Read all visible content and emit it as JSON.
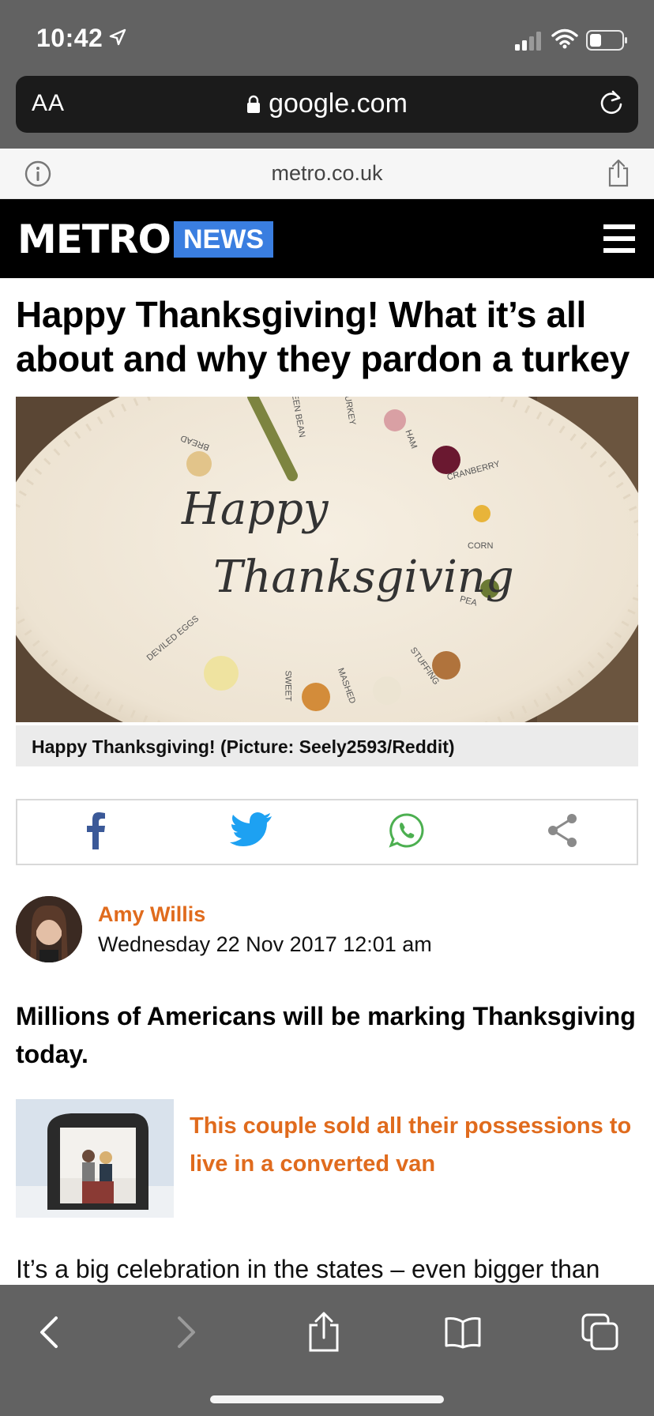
{
  "status": {
    "time": "10:42"
  },
  "browser": {
    "aa_label": "AA",
    "url": "google.com",
    "site_domain": "metro.co.uk"
  },
  "header": {
    "logo": "METRO",
    "section": "NEWS"
  },
  "article": {
    "headline": "Happy Thanksgiving! What it’s all about and why they pardon a turkey",
    "hero_image": {
      "handwritten": [
        "Happy",
        "Thanksgiving"
      ],
      "plate_labels": [
        "BREAD",
        "GREEN BEAN",
        "TURKEY",
        "HAM",
        "CRANBERRY",
        "CORN",
        "PEA",
        "STUFFING",
        "MASHED",
        "SWEET",
        "DEVILED EGGS"
      ]
    },
    "caption": "Happy Thanksgiving! (Picture: Seely2593/Reddit)",
    "share_buttons": [
      "facebook-icon",
      "twitter-icon",
      "whatsapp-icon",
      "share-icon"
    ],
    "author": {
      "name": "Amy Willis",
      "date": "Wednesday 22 Nov 2017 12:01 am"
    },
    "lede": "Millions of Americans will be marking Thanksgiving today.",
    "related": {
      "title": "This couple sold all their possessions to live in a converted van"
    },
    "body_first_line": "It’s a big celebration in the states – even bigger than"
  },
  "colors": {
    "accent_orange": "#e06b1d",
    "news_blue": "#3a7ee0",
    "facebook": "#3b5998",
    "twitter": "#1da1f2",
    "whatsapp": "#4caf50"
  }
}
